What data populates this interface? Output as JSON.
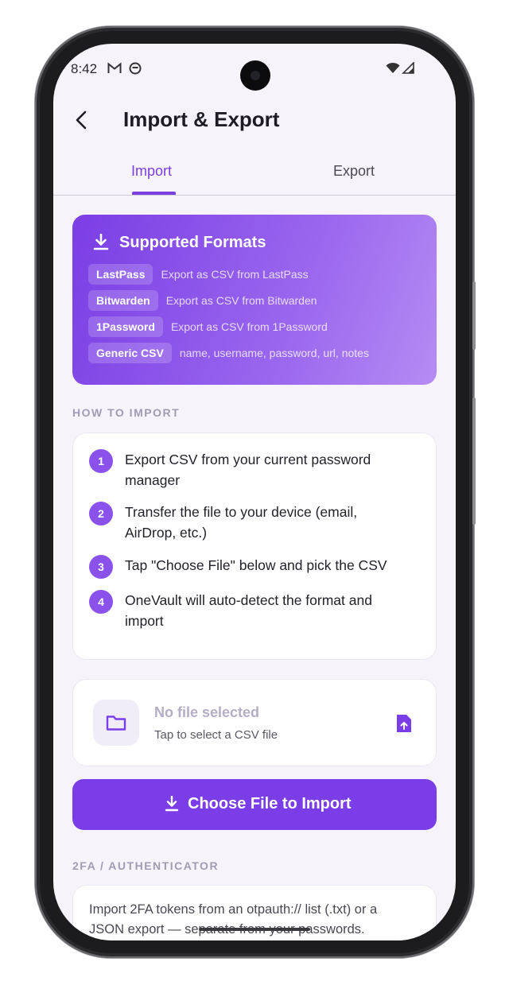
{
  "status_bar": {
    "time": "8:42",
    "icons": [
      "gmail-icon",
      "app-icon",
      "wifi-icon",
      "signal-icon"
    ]
  },
  "header": {
    "title": "Import & Export",
    "back_icon": "chevron-left-icon"
  },
  "tabs": [
    {
      "label": "Import",
      "selected": true
    },
    {
      "label": "Export",
      "selected": false
    }
  ],
  "supported_formats": {
    "title": "Supported Formats",
    "icon": "download-icon",
    "items": [
      {
        "name": "LastPass",
        "desc": "Export as CSV from LastPass"
      },
      {
        "name": "Bitwarden",
        "desc": "Export as CSV from Bitwarden"
      },
      {
        "name": "1Password",
        "desc": "Export as CSV from 1Password"
      },
      {
        "name": "Generic CSV",
        "desc": "name, username, password, url, notes"
      }
    ]
  },
  "how_to": {
    "label": "HOW TO IMPORT",
    "steps": [
      {
        "num": "1",
        "text": "Export CSV from your current password manager"
      },
      {
        "num": "2",
        "text": "Transfer the file to your device (email, AirDrop, etc.)"
      },
      {
        "num": "3",
        "text": "Tap \"Choose File\" below and pick the CSV"
      },
      {
        "num": "4",
        "text": "OneVault will auto-detect the format and import"
      }
    ]
  },
  "file": {
    "title": "No file selected",
    "subtitle": "Tap to select a CSV file",
    "icon": "folder-icon",
    "action_icon": "file-upload-icon"
  },
  "primary_button": {
    "label": "Choose File to Import",
    "icon": "download-icon"
  },
  "twofa": {
    "label": "2FA / AUTHENTICATOR",
    "text": "Import 2FA tokens from an otpauth:// list (.txt) or a JSON export — separate from your passwords."
  },
  "colors": {
    "accent": "#7a3de8",
    "background": "#f6f3fb",
    "muted_label": "#a19bb3"
  }
}
